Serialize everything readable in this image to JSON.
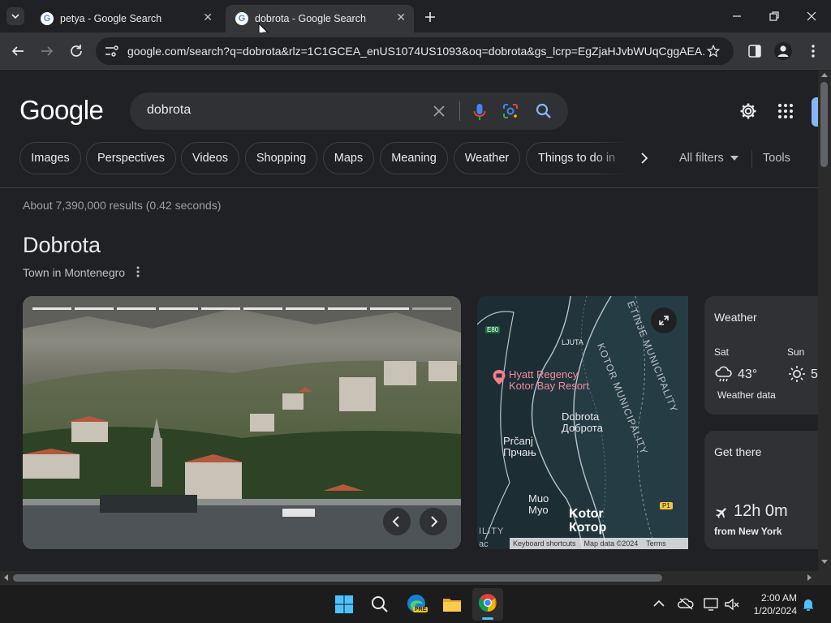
{
  "browser": {
    "tabs": [
      {
        "title": "petya - Google Search",
        "active": false
      },
      {
        "title": "dobrota - Google Search",
        "active": true
      }
    ],
    "url": "google.com/search?q=dobrota&rlz=1C1GCEA_enUS1074US1093&oq=dobrota&gs_lcrp=EgZjaHJvbWUqCggAEA..."
  },
  "search": {
    "logo": "Google",
    "query": "dobrota",
    "chips": [
      "Images",
      "Perspectives",
      "Videos",
      "Shopping",
      "Maps",
      "Meaning",
      "Weather",
      "Things to do in"
    ],
    "all_filters": "All filters",
    "tools": "Tools",
    "results_stats": "About 7,390,000 results (0.42 seconds)"
  },
  "knowledge_panel": {
    "title": "Dobrota",
    "subtitle": "Town in Montenegro",
    "map": {
      "labels": {
        "e80": "E80",
        "ljuta": "LJUTA",
        "hyatt_line1": "Hyatt Regency",
        "hyatt_line2": "Kotor Bay Resort",
        "dobrota": "Dobrota",
        "dobrota_cyr": "Доброта",
        "prcanj": "Prčanj",
        "prcanj_cyr": "Прчањ",
        "muo": "Muo",
        "muo_cyr": "Муо",
        "kotor": "Kotor",
        "kotor_cyr": "Котор",
        "p1": "P1",
        "kotor_municipality": "KOTOR MUNICIPALITY",
        "cetinje_municipality": "ETINJE MUNICIPALITY",
        "ility": "ILITY",
        "ac": "ac",
        "keyboard_shortcuts": "Keyboard shortcuts",
        "map_data": "Map data ©2024",
        "terms": "Terms"
      }
    },
    "weather": {
      "title": "Weather",
      "days": [
        {
          "day": "Sat",
          "temp": "43°"
        },
        {
          "day": "Sun",
          "temp": "5"
        }
      ],
      "source": "Weather data"
    },
    "get_there": {
      "title": "Get there",
      "duration": "12h 0m",
      "from": "from New York"
    }
  },
  "taskbar": {
    "time": "2:00 AM",
    "date": "1/20/2024",
    "edge_badge": "PRE"
  }
}
